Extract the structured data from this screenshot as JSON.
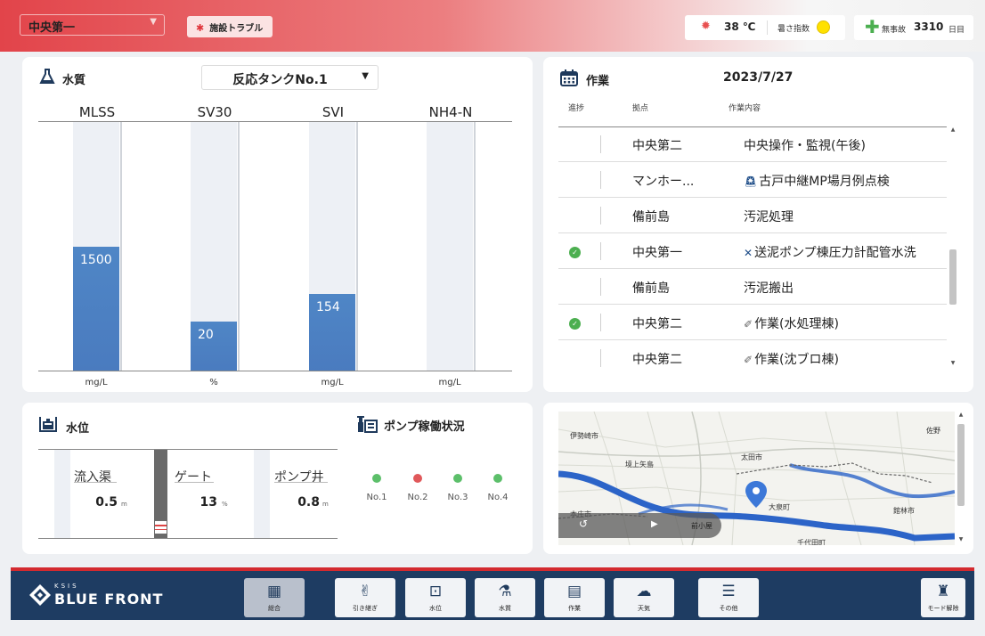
{
  "header": {
    "site": "中央第一",
    "trouble_label": "施設トラブル",
    "temperature": "38 ℃",
    "heat_index_label": "暑さ指数",
    "heat_index_color": "#ffe100",
    "safety_label": "無事故",
    "safety_days": "3310",
    "safety_unit": "日目"
  },
  "water_quality": {
    "title": "水質",
    "tank": "反応タンクNo.1",
    "params": [
      {
        "name": "MLSS",
        "value": "1500",
        "unit": "mg/L",
        "fill": 0.5
      },
      {
        "name": "SV30",
        "value": "20",
        "unit": "%",
        "fill": 0.2
      },
      {
        "name": "SVI",
        "value": "154",
        "unit": "mg/L",
        "fill": 0.31
      },
      {
        "name": "NH4-N",
        "value": "",
        "unit": "mg/L",
        "fill": 0
      }
    ]
  },
  "work": {
    "title": "作業",
    "date": "2023/7/27",
    "col_progress": "進捗",
    "col_site": "拠点",
    "col_content": "作業内容",
    "rows": [
      {
        "done": false,
        "site": "中央第二",
        "icon": "",
        "task": "中央操作・監視(午後)"
      },
      {
        "done": false,
        "site": "マンホー...",
        "icon": "alarm",
        "task": "古戸中継MP場月例点検"
      },
      {
        "done": false,
        "site": "備前島",
        "icon": "",
        "task": "汚泥処理"
      },
      {
        "done": true,
        "site": "中央第一",
        "icon": "tools",
        "task": "送泥ポンプ棟圧力計配管水洗"
      },
      {
        "done": false,
        "site": "備前島",
        "icon": "",
        "task": "汚泥搬出"
      },
      {
        "done": true,
        "site": "中央第二",
        "icon": "pen",
        "task": "作業(水処理棟)"
      },
      {
        "done": false,
        "site": "中央第二",
        "icon": "pen",
        "task": "作業(沈ブロ棟)"
      }
    ]
  },
  "water_level": {
    "title": "水位",
    "items": [
      {
        "name": "流入渠",
        "value": "0.5",
        "unit": "m"
      },
      {
        "name": "ゲート",
        "value": "13",
        "unit": "%"
      },
      {
        "name": "ポンプ井",
        "value": "0.8",
        "unit": "m"
      }
    ]
  },
  "pumps": {
    "title": "ポンプ稼働状況",
    "items": [
      {
        "label": "No.1",
        "color": "#5cbf6a"
      },
      {
        "label": "No.2",
        "color": "#e0585a"
      },
      {
        "label": "No.3",
        "color": "#5cbf6a"
      },
      {
        "label": "No.4",
        "color": "#5cbf6a"
      }
    ]
  },
  "map": {
    "labels": [
      "伊勢崎市",
      "佐野",
      "境上矢島",
      "太田市",
      "大泉町",
      "館林市",
      "本庄市",
      "前小屋",
      "千代田町"
    ]
  },
  "nav": {
    "logo_small": "KSIS",
    "logo_main": "BLUE FRONT",
    "items": [
      "総合",
      "引き継ぎ",
      "水位",
      "水質",
      "作業",
      "天気",
      "その他"
    ],
    "mode_release": "モード解除"
  }
}
